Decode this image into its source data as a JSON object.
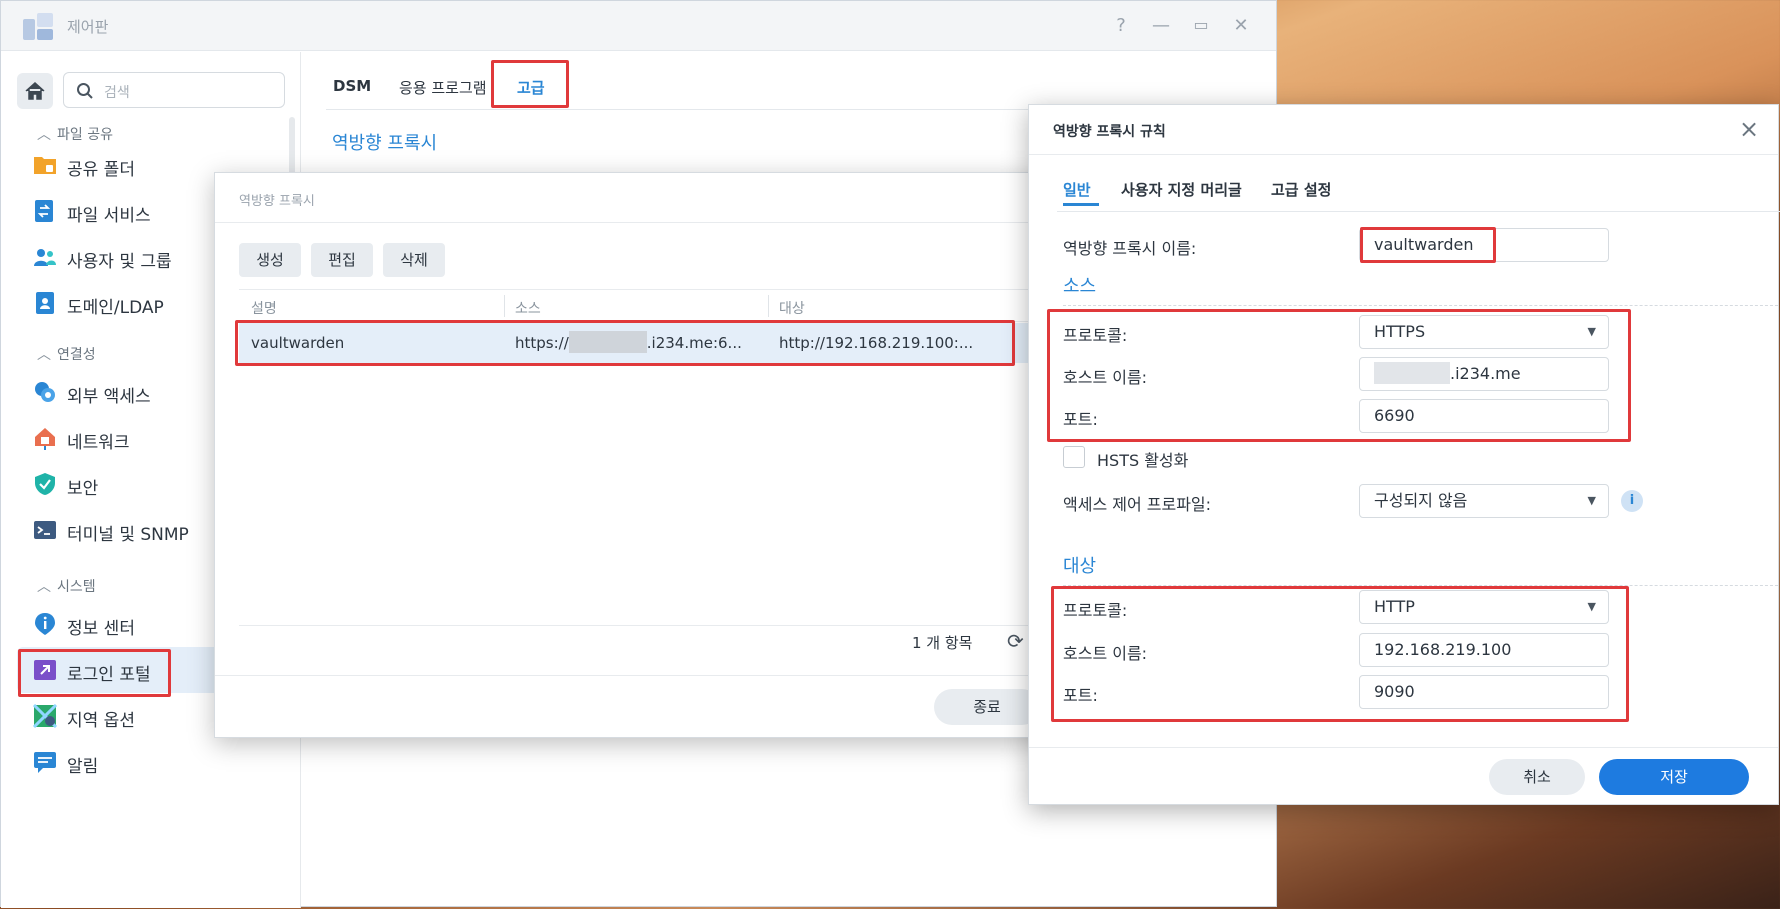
{
  "window": {
    "title": "제어판",
    "help": "?",
    "minimize": "—",
    "maximize": "▭",
    "close": "✕"
  },
  "sidebar": {
    "search_placeholder": "검색",
    "sections": [
      {
        "label": "파일 공유"
      },
      {
        "label": "연결성"
      },
      {
        "label": "시스템"
      }
    ],
    "items": [
      {
        "label": "공유 폴더",
        "icon": "folder-icon"
      },
      {
        "label": "파일 서비스",
        "icon": "file-services-icon"
      },
      {
        "label": "사용자 및 그룹",
        "icon": "users-icon"
      },
      {
        "label": "도메인/LDAP",
        "icon": "domain-icon"
      },
      {
        "label": "외부 액세스",
        "icon": "external-access-icon"
      },
      {
        "label": "네트워크",
        "icon": "network-icon"
      },
      {
        "label": "보안",
        "icon": "shield-icon"
      },
      {
        "label": "터미널 및 SNMP",
        "icon": "terminal-icon"
      },
      {
        "label": "정보 센터",
        "icon": "info-icon"
      },
      {
        "label": "로그인 포털",
        "icon": "login-portal-icon"
      },
      {
        "label": "지역 옵션",
        "icon": "region-icon"
      },
      {
        "label": "알림",
        "icon": "notification-icon"
      }
    ]
  },
  "content": {
    "tabs": [
      "DSM",
      "응용 프로그램",
      "고급"
    ],
    "active_tab": "고급",
    "heading": "역방향 프록시"
  },
  "proxy_list": {
    "title": "역방향 프록시",
    "buttons": {
      "create": "생성",
      "edit": "편집",
      "delete": "삭제"
    },
    "columns": [
      "설명",
      "소스",
      "대상"
    ],
    "rows": [
      {
        "description": "vaultwarden",
        "source_prefix": "https://",
        "source_suffix": ".i234.me:6...",
        "target": "http://192.168.219.100:..."
      }
    ],
    "count": "1 개 항목",
    "close": "종료"
  },
  "rule_dialog": {
    "title": "역방향 프록시 규칙",
    "tabs": [
      "일반",
      "사용자 지정 머리글",
      "고급 설정"
    ],
    "name_label": "역방향 프록시 이름:",
    "name_value": "vaultwarden",
    "source": {
      "heading": "소스",
      "protocol_label": "프로토콜:",
      "protocol_value": "HTTPS",
      "host_label": "호스트 이름:",
      "host_value": ".i234.me",
      "port_label": "포트:",
      "port_value": "6690",
      "hsts_label": "HSTS 활성화",
      "acl_label": "액세스 제어 프로파일:",
      "acl_value": "구성되지 않음"
    },
    "target": {
      "heading": "대상",
      "protocol_label": "프로토콜:",
      "protocol_value": "HTTP",
      "host_label": "호스트 이름:",
      "host_value": "192.168.219.100",
      "port_label": "포트:",
      "port_value": "9090"
    },
    "cancel": "취소",
    "save": "저장"
  },
  "colors": {
    "accent": "#2a86d4",
    "highlight": "#e0393b",
    "primary_button": "#1e7be0"
  }
}
